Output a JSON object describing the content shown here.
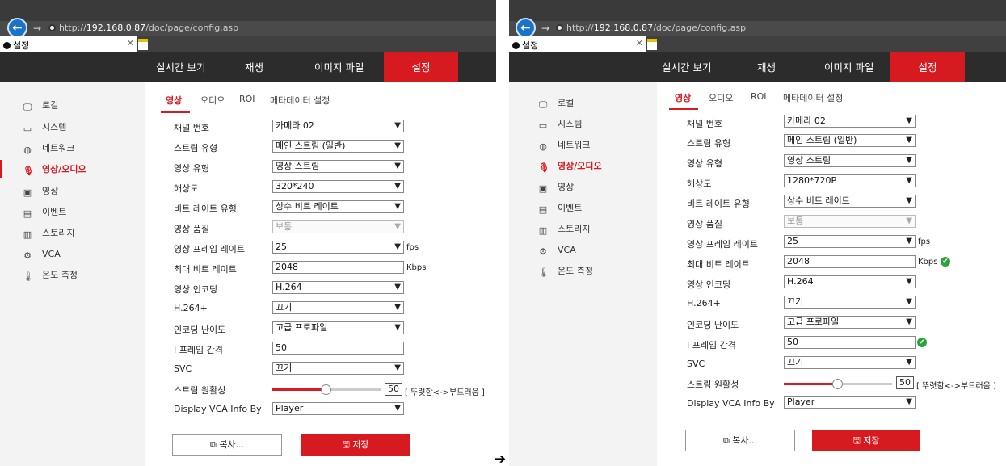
{
  "arrow": "➔",
  "screens": [
    {
      "url_prefix": "http://",
      "url_host": "192.168.0.87",
      "url_path": "/doc/page/config.asp",
      "tab_title": "설정",
      "nav": {
        "live": "실시간 보기",
        "playback": "재생",
        "picture": "이미지 파일",
        "config": "설정"
      },
      "sidebar": [
        "로컬",
        "시스템",
        "네트워크",
        "영상/오디오",
        "영상",
        "이벤트",
        "스토리지",
        "VCA",
        "온도 측정"
      ],
      "subtabs": [
        "영상",
        "오디오",
        "ROI",
        "메타데이터 설정"
      ],
      "fields": {
        "channel": {
          "label": "채널 번호",
          "value": "카메라 02"
        },
        "stream_type": {
          "label": "스트림 유형",
          "value": "메인 스트림 (일반)"
        },
        "video_type": {
          "label": "영상 유형",
          "value": "영상 스트림"
        },
        "resolution": {
          "label": "해상도",
          "value": "320*240"
        },
        "bitrate_type": {
          "label": "비트 레이트 유형",
          "value": "상수 비트 레이트"
        },
        "video_quality": {
          "label": "영상 품질",
          "value": "보통"
        },
        "frame_rate": {
          "label": "영상 프레임 레이트",
          "value": "25",
          "unit": "fps"
        },
        "max_bitrate": {
          "label": "최대 비트 레이트",
          "value": "2048",
          "unit": "Kbps"
        },
        "encoding": {
          "label": "영상 인코딩",
          "value": "H.264"
        },
        "h264plus": {
          "label": "H.264+",
          "value": "끄기"
        },
        "profile": {
          "label": "인코딩 난이도",
          "value": "고급 프로파일"
        },
        "i_frame": {
          "label": "I 프레임 간격",
          "value": "50"
        },
        "svc": {
          "label": "SVC",
          "value": "끄기"
        },
        "smoothing": {
          "label": "스트림 원활성",
          "value": "50",
          "hint": "[ 뚜렷함<->부드러움 ]",
          "level": 0.5
        },
        "vca_info": {
          "label": "Display VCA Info By",
          "value": "Player"
        }
      },
      "buttons": {
        "copy": "복사...",
        "save": "저장"
      },
      "show_ok": false
    },
    {
      "url_prefix": "http://",
      "url_host": "192.168.0.87",
      "url_path": "/doc/page/config.asp",
      "tab_title": "설정",
      "nav": {
        "live": "실시간 보기",
        "playback": "재생",
        "picture": "이미지 파일",
        "config": "설정"
      },
      "sidebar": [
        "로컬",
        "시스템",
        "네트워크",
        "영상/오디오",
        "영상",
        "이벤트",
        "스토리지",
        "VCA",
        "온도 측정"
      ],
      "subtabs": [
        "영상",
        "오디오",
        "ROI",
        "메타데이터 설정"
      ],
      "fields": {
        "channel": {
          "label": "채널 번호",
          "value": "카메라 02"
        },
        "stream_type": {
          "label": "스트림 유형",
          "value": "메인 스트림 (일반)"
        },
        "video_type": {
          "label": "영상 유형",
          "value": "영상 스트림"
        },
        "resolution": {
          "label": "해상도",
          "value": "1280*720P"
        },
        "bitrate_type": {
          "label": "비트 레이트 유형",
          "value": "상수 비트 레이트"
        },
        "video_quality": {
          "label": "영상 품질",
          "value": "보통"
        },
        "frame_rate": {
          "label": "영상 프레임 레이트",
          "value": "25",
          "unit": "fps"
        },
        "max_bitrate": {
          "label": "최대 비트 레이트",
          "value": "2048",
          "unit": "Kbps"
        },
        "encoding": {
          "label": "영상 인코딩",
          "value": "H.264"
        },
        "h264plus": {
          "label": "H.264+",
          "value": "끄기"
        },
        "profile": {
          "label": "인코딩 난이도",
          "value": "고급 프로파일"
        },
        "i_frame": {
          "label": "I 프레임 간격",
          "value": "50"
        },
        "svc": {
          "label": "SVC",
          "value": "끄기"
        },
        "smoothing": {
          "label": "스트림 원활성",
          "value": "50",
          "hint": "[ 뚜렷함<->부드러움 ]",
          "level": 0.5
        },
        "vca_info": {
          "label": "Display VCA Info By",
          "value": "Player"
        }
      },
      "buttons": {
        "copy": "복사...",
        "save": "저장"
      },
      "show_ok": true
    }
  ]
}
